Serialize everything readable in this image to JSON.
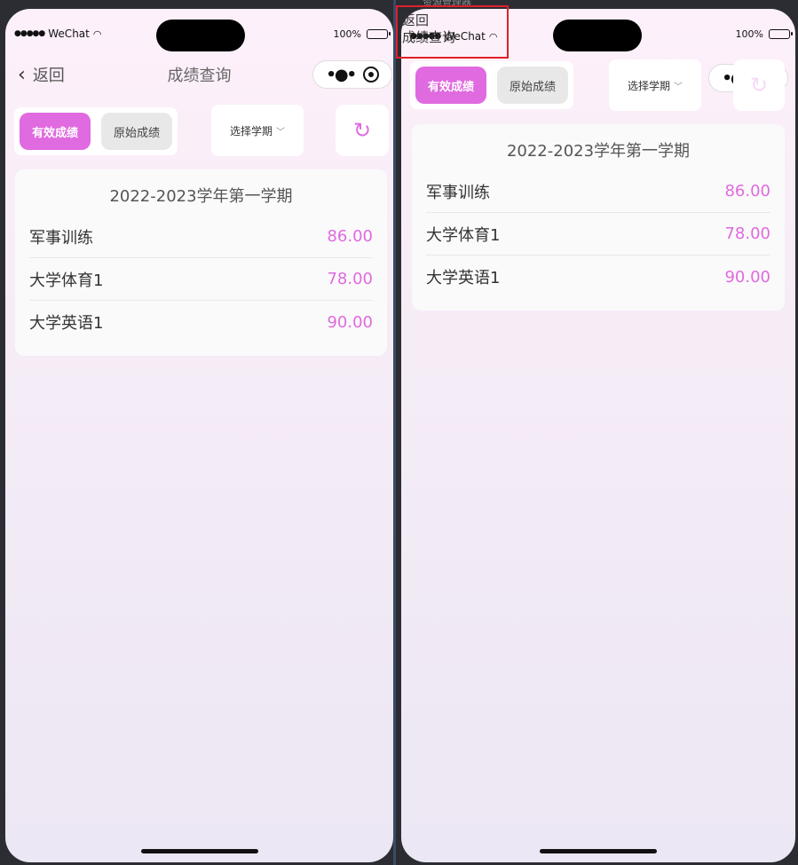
{
  "status": {
    "carrier": "WeChat",
    "battery": "100%"
  },
  "nav": {
    "back_label": "返回",
    "title": "成绩查询"
  },
  "tabs": [
    {
      "label": "有效成绩",
      "active": true
    },
    {
      "label": "原始成绩",
      "active": false
    }
  ],
  "term_select": {
    "label": "选择学期"
  },
  "term": {
    "title": "2022-2023学年第一学期",
    "courses": [
      {
        "name": "军事训练",
        "score": "86.00"
      },
      {
        "name": "大学体育1",
        "score": "78.00"
      },
      {
        "name": "大学英语1",
        "score": "90.00"
      }
    ]
  },
  "overlay": {
    "line1": "返回",
    "line2": "成绩查询"
  },
  "top_glimpse": "资源管理器",
  "colors": {
    "accent": "#e06ae0",
    "highlight_box": "#e0202a"
  },
  "icons": {
    "back": "chevron-left-icon",
    "more": "more-dots-icon",
    "close": "target-icon",
    "refresh": "refresh-icon",
    "dropdown": "chevron-down-icon"
  }
}
